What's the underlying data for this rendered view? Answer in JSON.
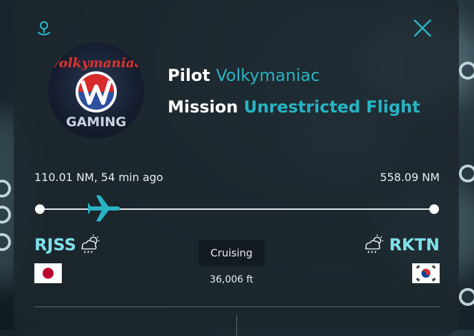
{
  "map": {
    "background": "#1e2d35"
  },
  "header": {
    "location_icon": "map-pin-icon",
    "close_icon": "close-icon",
    "accent": "#28b4c3"
  },
  "avatar": {
    "brand_top": "Volkymaniac",
    "brand_bottom": "GAMING"
  },
  "pilot": {
    "label": "Pilot",
    "value": "Volkymaniac"
  },
  "mission": {
    "label": "Mission",
    "value": "Unrestricted Flight"
  },
  "progress": {
    "flown": "110.01 NM, 54 min ago",
    "remaining": "558.09 NM",
    "fraction_complete": 0.165
  },
  "origin": {
    "icao": "RJSS",
    "weather_icon": "rain-cloud-sun-icon",
    "flag": "japan-flag"
  },
  "destination": {
    "icao": "RKTN",
    "weather_icon": "rain-cloud-sun-icon",
    "flag": "south-korea-flag"
  },
  "flight": {
    "phase": "Cruising",
    "altitude": "36,006 ft"
  }
}
